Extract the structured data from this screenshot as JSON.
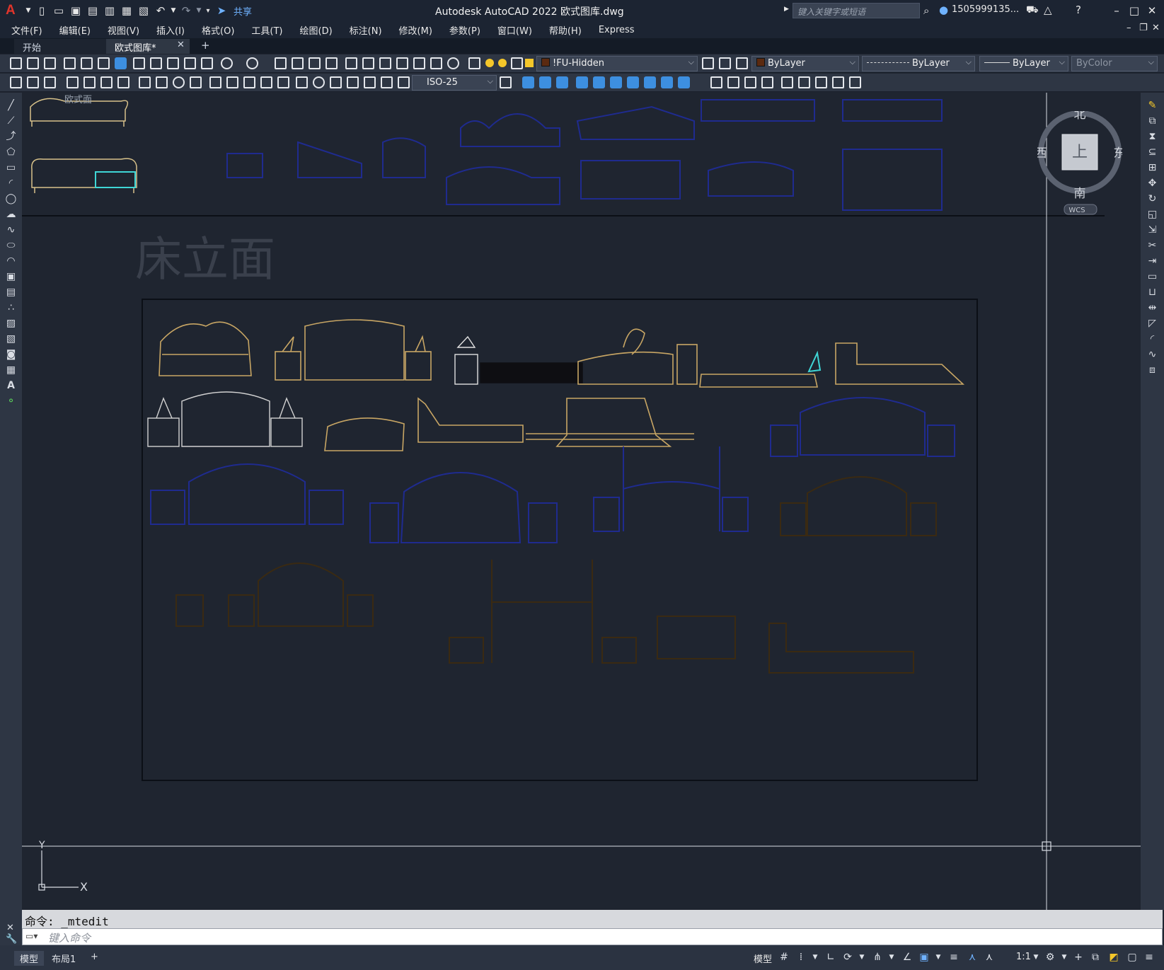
{
  "title_bar": {
    "app_logo": "A",
    "share_label": "共享",
    "window_title": "Autodesk AutoCAD 2022    欧式图库.dwg",
    "search_placeholder": "键入关键字或短语",
    "user_name": "1505999135..."
  },
  "menu": [
    "文件(F)",
    "编辑(E)",
    "视图(V)",
    "插入(I)",
    "格式(O)",
    "工具(T)",
    "绘图(D)",
    "标注(N)",
    "修改(M)",
    "参数(P)",
    "窗口(W)",
    "帮助(H)",
    "Express"
  ],
  "tabs": {
    "start": "开始",
    "drawing": "欧式图库*",
    "close": "✕",
    "add": "+"
  },
  "toolbar1": {
    "layer_dropdown": "!FU-Hidden",
    "color_dropdown": "ByLayer",
    "linetype_dropdown": "ByLayer",
    "lineweight_dropdown": "ByLayer",
    "plotstyle_dropdown": "ByColor"
  },
  "toolbar2": {
    "dimstyle_dropdown": "ISO-25"
  },
  "drawing": {
    "section_title": "床立面",
    "partial_label": "欧式面",
    "ucs_y": "Y",
    "ucs_x": "X"
  },
  "viewcube": {
    "north": "北",
    "south": "南",
    "east": "东",
    "west": "西",
    "top_face": "上",
    "wcs": "WCS"
  },
  "command": {
    "history": "命令:  _mtedit",
    "placeholder": "键入命令"
  },
  "status_bar": {
    "model_tab": "模型",
    "layout_tab": "布局1",
    "add_tab": "+",
    "model_label": "模型",
    "scale": "1:1"
  },
  "colors": {
    "background": "#1f2530",
    "gold": "#c8a664",
    "white_line": "#dcdcdc",
    "dark_blue": "#1f2b8f",
    "brown": "#4a3212",
    "cyan": "#3fd6d6"
  }
}
